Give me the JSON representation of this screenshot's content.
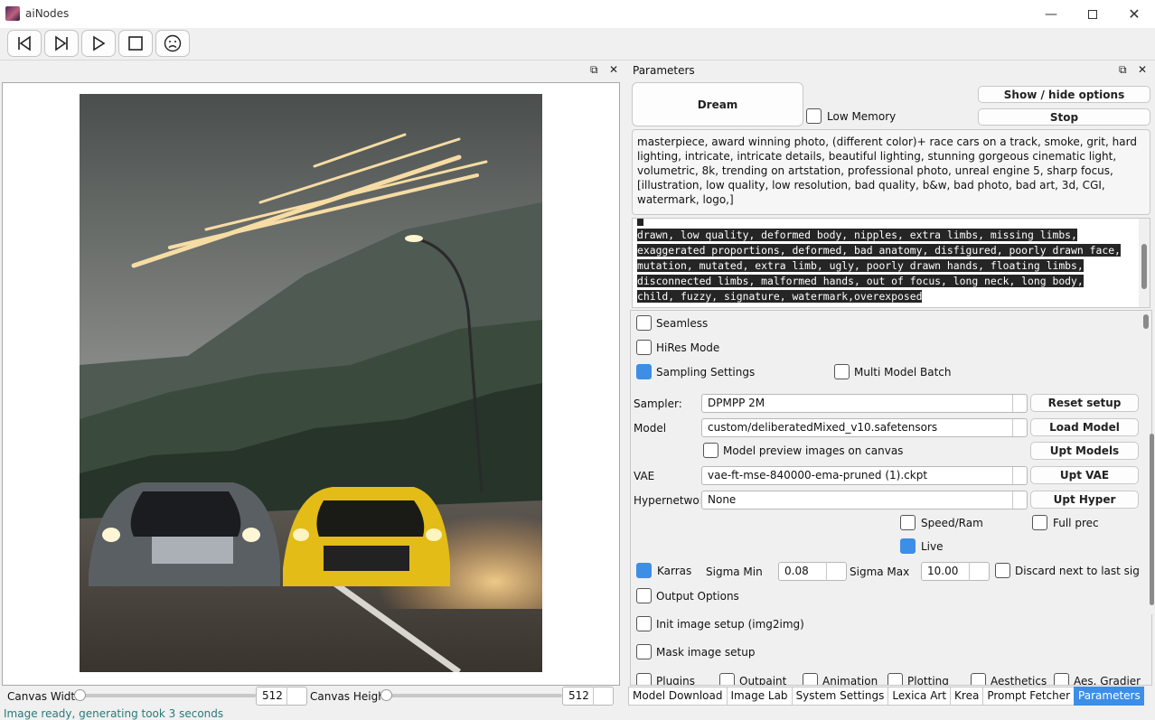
{
  "window": {
    "title": "aiNodes"
  },
  "toolbar": {
    "buttons": [
      "skip-back-icon",
      "skip-forward-icon",
      "play-icon",
      "stop-icon",
      "frown-icon"
    ]
  },
  "parameters": {
    "header": "Parameters",
    "dream_label": "Dream",
    "low_memory_label": "Low Memory",
    "low_memory_checked": false,
    "show_hide_label": "Show / hide options",
    "stop_label": "Stop",
    "prompt": "masterpiece, award winning photo, (different color)+ race cars on a track, smoke, grit, hard lighting, intricate, intricate details, beautiful lighting, stunning gorgeous cinematic light, volumetric, 8k, trending on artstation, professional photo, unreal engine 5, sharp focus, [illustration, low quality, low resolution, bad quality, b&w, bad photo, bad art, 3d, CGI, watermark, logo,]",
    "negative_lines": [
      "drawn, low quality, deformed body, nipples, extra limbs, missing limbs,",
      "exaggerated proportions, deformed, bad anatomy, disfigured, poorly drawn face,",
      "mutation, mutated, extra limb, ugly, poorly drawn hands, floating limbs,",
      "disconnected limbs, malformed hands, out of focus, long neck, long body,",
      "child, fuzzy, signature, watermark,overexposed"
    ],
    "seamless_label": "Seamless",
    "hires_label": "HiRes Mode",
    "sampling_label": "Sampling Settings",
    "multi_model_label": "Multi Model Batch",
    "sampler_label": "Sampler:",
    "sampler_value": "DPMPP 2M",
    "reset_label": "Reset setup",
    "model_label": "Model",
    "model_value": "custom/deliberatedMixed_v10.safetensors",
    "load_model_label": "Load Model",
    "preview_label": "Model preview images on canvas",
    "upt_models_label": "Upt Models",
    "vae_label": "VAE",
    "vae_value": "vae-ft-mse-840000-ema-pruned (1).ckpt",
    "upt_vae_label": "Upt VAE",
    "hypernet_label": "Hypernetwork",
    "hypernet_value": "None",
    "upt_hyper_label": "Upt Hyper",
    "speed_ram_label": "Speed/Ram",
    "full_prec_label": "Full prec",
    "live_label": "Live",
    "karras_label": "Karras",
    "sigma_min_label": "Sigma Min",
    "sigma_min_value": "0.08",
    "sigma_max_label": "Sigma Max",
    "sigma_max_value": "10.00",
    "discard_label": "Discard next to last sigma",
    "output_label": "Output Options",
    "init_label": "Init image setup (img2img)",
    "mask_label": "Mask image setup",
    "bottom_row": [
      "Plugins",
      "Outpaint",
      "Animation",
      "Plotting",
      "Aesthetics",
      "Aes. Gradient"
    ]
  },
  "canvas": {
    "width_label": "Canvas Width",
    "width_value": "512",
    "height_label": "Canvas Height",
    "height_value": "512"
  },
  "status": {
    "text": "Image ready, generating took 3 seconds"
  },
  "tabs": [
    "Model Download",
    "Image Lab",
    "System Settings",
    "Lexica Art",
    "Krea",
    "Prompt Fetcher",
    "Parameters"
  ],
  "active_tab": "Parameters"
}
